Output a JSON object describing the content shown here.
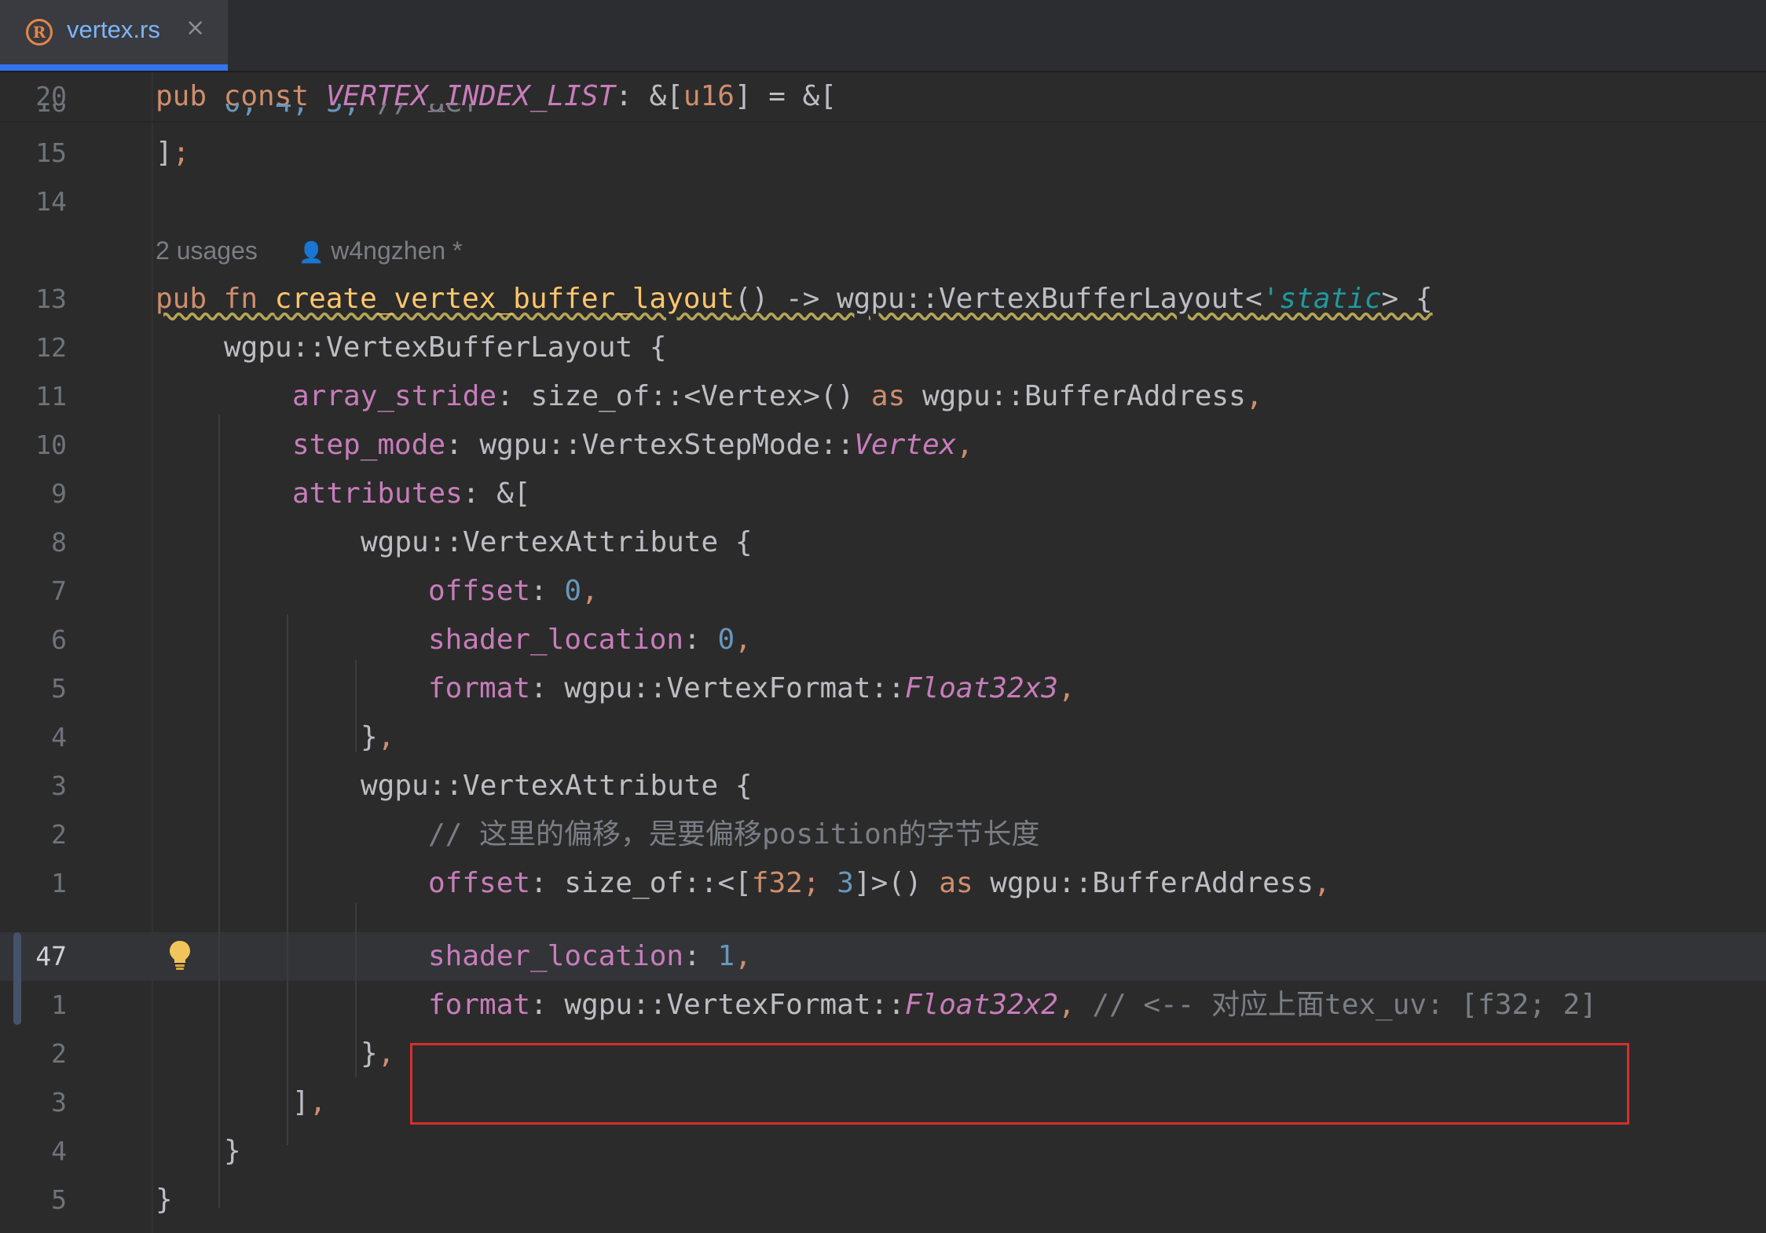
{
  "tab": {
    "title": "vertex.rs",
    "close_glyph": "×",
    "icon_letter": "R"
  },
  "inlay": {
    "usages": "2 usages",
    "author": "w4ngzhen *"
  },
  "lines": [
    {
      "num": "20"
    },
    {
      "num": "16"
    },
    {
      "num": "15"
    },
    {
      "num": "14"
    },
    {
      "num": "13"
    },
    {
      "num": "12"
    },
    {
      "num": "11"
    },
    {
      "num": "10"
    },
    {
      "num": "9"
    },
    {
      "num": "8"
    },
    {
      "num": "7"
    },
    {
      "num": "6"
    },
    {
      "num": "5"
    },
    {
      "num": "4"
    },
    {
      "num": "3"
    },
    {
      "num": "2"
    },
    {
      "num": "1"
    },
    {
      "num": "47"
    },
    {
      "num": "1"
    },
    {
      "num": "2"
    },
    {
      "num": "3"
    },
    {
      "num": "4"
    },
    {
      "num": "5"
    }
  ],
  "code": {
    "l20_a": "pub const ",
    "l20_b": "VERTEX_INDEX_LIST",
    "l20_c": ": &[",
    "l20_d": "u16",
    "l20_e": "] = &[",
    "l16_a": "0, 4, 5, ",
    "l16_b": "// aef",
    "l15_a": "]",
    "l15_b": ";",
    "l13_a": "pub fn ",
    "l13_b": "create_vertex_buffer_layout",
    "l13_c": "() -> wgpu::VertexBufferLayout<",
    "l13_d": "'static",
    "l13_e": "> {",
    "l12": "wgpu::VertexBufferLayout {",
    "l11_a": "array_stride",
    "l11_b": ": size_of::<Vertex>() ",
    "l11_c": "as",
    "l11_d": " wgpu::BufferAddress",
    "l11_e": ",",
    "l10_a": "step_mode",
    "l10_b": ": wgpu::VertexStepMode::",
    "l10_c": "Vertex",
    "l10_d": ",",
    "l9_a": "attributes",
    "l9_b": ": &[",
    "l8": "wgpu::VertexAttribute {",
    "l7_a": "offset",
    "l7_b": ": ",
    "l7_c": "0",
    "l7_d": ",",
    "l6_a": "shader_location",
    "l6_b": ": ",
    "l6_c": "0",
    "l6_d": ",",
    "l5_a": "format",
    "l5_b": ": wgpu::VertexFormat::",
    "l5_c": "Float32x3",
    "l5_d": ",",
    "l4_a": "}",
    "l4_b": ",",
    "l3": "wgpu::VertexAttribute {",
    "l2": "// 这里的偏移，是要偏移position的字节长度",
    "l1_a": "offset",
    "l1_b": ": size_of::<[",
    "l1_c": "f32",
    "l1_d": "; ",
    "l1_e": "3",
    "l1_f": "]>() ",
    "l1_g": "as",
    "l1_h": " wgpu::BufferAddress",
    "l1_i": ",",
    "l47_a": "shader_location",
    "l47_b": ": ",
    "l47_c": "1",
    "l47_d": ",",
    "lb1_a": "format",
    "lb1_b": ": wgpu::VertexFormat::",
    "lb1_c": "Float32x2",
    "lb1_d": ",",
    "lb1_e": " // <-- 对应上面tex_uv: [f32; 2]",
    "lb2_a": "}",
    "lb2_b": ",",
    "lb3_a": "]",
    "lb3_b": ",",
    "lb4": "}",
    "lb5": "}"
  },
  "colors": {
    "highlight_box": "#d32f2f",
    "accent": "#3574f0"
  }
}
